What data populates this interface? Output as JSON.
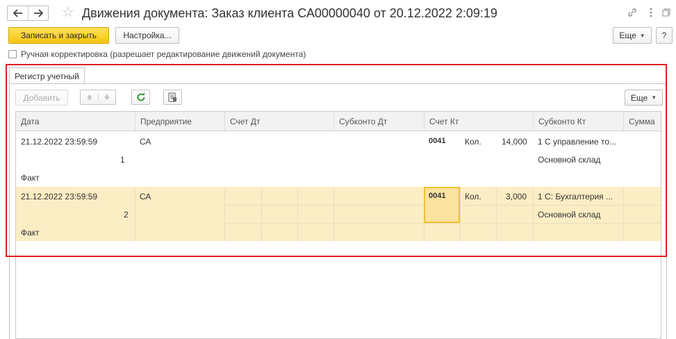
{
  "window": {
    "title": "Движения документа: Заказ клиента СА00000040 от 20.12.2022 2:09:19",
    "back_icon": "arrow-left-icon",
    "forward_icon": "arrow-right-icon",
    "favorite_icon": "star-icon",
    "link_icon": "link-icon",
    "menu_icon": "more-vertical-icon",
    "restore_icon": "restore-icon",
    "close_icon": "close-icon"
  },
  "toolbar": {
    "save_close_label": "Записать и закрыть",
    "settings_label": "Настройка...",
    "more_label": "Еще",
    "help_label": "?"
  },
  "manual_edit": {
    "label": "Ручная корректировка (разрешает редактирование движений документа)",
    "checked": false
  },
  "tabs": [
    {
      "label": "Регистр учетный",
      "active": true
    }
  ],
  "register_toolbar": {
    "add_label": "Добавить",
    "more_label": "Еще"
  },
  "table": {
    "columns": [
      "Дата",
      "Предприятие",
      "Счет Дт",
      "Субконто Дт",
      "Счет Кт",
      "Субконто Кт",
      "Сумма"
    ],
    "rows": [
      {
        "date": "21.12.2022 23:59:59",
        "line_no": "1",
        "type": "Факт",
        "enterprise": "СА",
        "account_kt": "0041",
        "qty_label": "Кол.",
        "qty": "14,000",
        "subconto_kt_1": "1 С управление то...",
        "subconto_kt_2": "Основной склад",
        "selected": false
      },
      {
        "date": "21.12.2022 23:59:59",
        "line_no": "2",
        "type": "Факт",
        "enterprise": "СА",
        "account_kt": "0041",
        "qty_label": "Кол.",
        "qty": "3,000",
        "subconto_kt_1": "1 С:  Бухгалтерия ...",
        "subconto_kt_2": "Основной склад",
        "selected": true
      }
    ]
  },
  "colors": {
    "primary_button": "#f4c513",
    "selected_row": "#fbedc4",
    "highlight_frame": "#e01f1f"
  }
}
